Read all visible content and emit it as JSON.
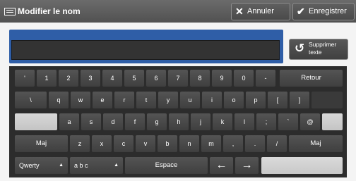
{
  "header": {
    "title": "Modifier le nom",
    "cancel_label": "Annuler",
    "save_label": "Enregistrer"
  },
  "input": {
    "value": ""
  },
  "delete_button": {
    "label": "Supprimer\ntexte"
  },
  "keyboard": {
    "row1": [
      "'",
      "1",
      "2",
      "3",
      "4",
      "5",
      "6",
      "7",
      "8",
      "9",
      "0",
      "-"
    ],
    "backspace": "Retour",
    "row2": [
      "\\",
      "q",
      "w",
      "e",
      "r",
      "t",
      "y",
      "u",
      "i",
      "o",
      "p",
      "[",
      "]"
    ],
    "row3": [
      "a",
      "s",
      "d",
      "f",
      "g",
      "h",
      "j",
      "k",
      "l",
      ";",
      "`",
      "@"
    ],
    "shift_left": "Maj",
    "row4": [
      "z",
      "x",
      "c",
      "v",
      "b",
      "n",
      "m",
      ",",
      ".",
      "/"
    ],
    "shift_right": "Maj",
    "layout_select": "Qwerty",
    "mode_select": "a b c",
    "space": "Espace",
    "left_arrow": "←",
    "right_arrow": "→",
    "up_arrow": "▲"
  }
}
